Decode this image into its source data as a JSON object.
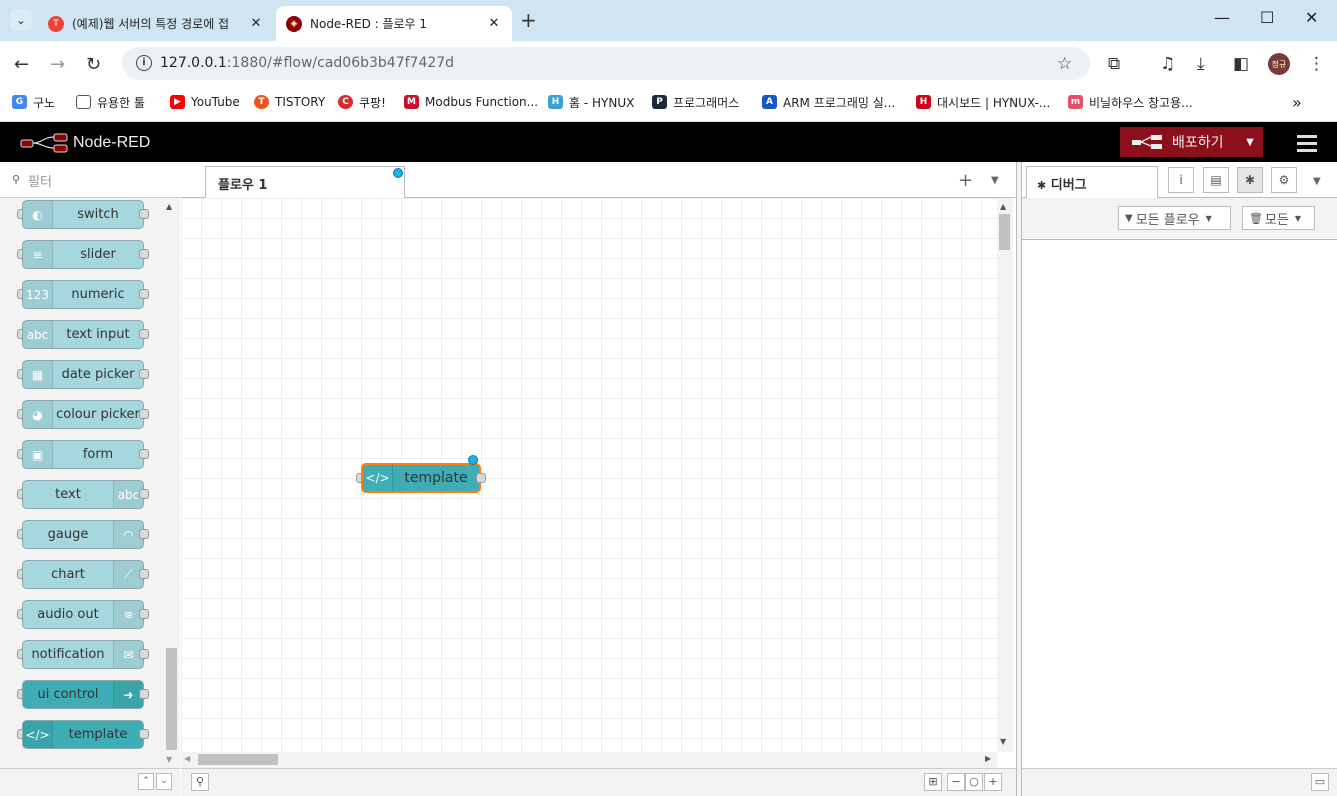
{
  "browser": {
    "tabs": [
      {
        "title": "(예제)웹 서버의 특정 경로에 접",
        "active": false,
        "favicon_color": "#e8453c"
      },
      {
        "title": "Node-RED : 플로우 1",
        "active": true,
        "favicon_color": "#8f0000"
      }
    ],
    "url": {
      "host": "127.0.0.1",
      "rest": ":1880/#flow/cad06b3b47f7427d"
    },
    "bookmarks": [
      {
        "label": "구노",
        "color": "#4285f4",
        "icon": "G"
      },
      {
        "label": "유용한 툴",
        "color": "#555555",
        "icon": "folder"
      },
      {
        "label": "YouTube",
        "color": "#ff0000",
        "icon": "▶"
      },
      {
        "label": "TISTORY",
        "color": "#eb531f",
        "icon": "T"
      },
      {
        "label": "쿠팡!",
        "color": "#d92b2b",
        "icon": "C"
      },
      {
        "label": "Modbus Function...",
        "color": "#c8102e",
        "icon": "M"
      },
      {
        "label": "홈 - HYNUX",
        "color": "#3aa3d6",
        "icon": "H"
      },
      {
        "label": "프로그래머스",
        "color": "#1e2a3a",
        "icon": "P"
      },
      {
        "label": "ARM 프로그래밍 실...",
        "color": "#1a56c9",
        "icon": "A"
      },
      {
        "label": "대시보드 | HYNUX-...",
        "color": "#d0021b",
        "icon": "H"
      },
      {
        "label": "비닐하우스 창고용...",
        "color": "#e94d6a",
        "icon": "m"
      }
    ],
    "avatar_text": "정규"
  },
  "nodered": {
    "title": "Node-RED",
    "deploy_label": "배포하기",
    "filter_placeholder": "필터",
    "palette": [
      {
        "label": "switch",
        "icon": "toggle-icon",
        "glyph": "◐",
        "dark": false,
        "right": false
      },
      {
        "label": "slider",
        "icon": "slider-icon",
        "glyph": "≡",
        "dark": false,
        "right": false
      },
      {
        "label": "numeric",
        "icon": "numeric-icon",
        "glyph": "123",
        "dark": false,
        "right": false
      },
      {
        "label": "text input",
        "icon": "text-input-icon",
        "glyph": "abc",
        "dark": false,
        "right": false
      },
      {
        "label": "date picker",
        "icon": "calendar-icon",
        "glyph": "▦",
        "dark": false,
        "right": false
      },
      {
        "label": "colour picker",
        "icon": "palette-icon",
        "glyph": "◕",
        "dark": false,
        "right": false
      },
      {
        "label": "form",
        "icon": "form-icon",
        "glyph": "▣",
        "dark": false,
        "right": false
      },
      {
        "label": "text",
        "icon": "text-icon",
        "glyph": "abc",
        "dark": false,
        "right": true
      },
      {
        "label": "gauge",
        "icon": "gauge-icon",
        "glyph": "◠",
        "dark": false,
        "right": true
      },
      {
        "label": "chart",
        "icon": "chart-icon",
        "glyph": "⟋",
        "dark": false,
        "right": true
      },
      {
        "label": "audio out",
        "icon": "audio-icon",
        "glyph": "≋",
        "dark": false,
        "right": true
      },
      {
        "label": "notification",
        "icon": "envelope-icon",
        "glyph": "✉",
        "dark": false,
        "right": true
      },
      {
        "label": "ui control",
        "icon": "arrow-icon",
        "glyph": "➜",
        "dark": true,
        "right": true
      },
      {
        "label": "template",
        "icon": "code-icon",
        "glyph": "</>",
        "dark": true,
        "right": false
      }
    ],
    "flow_tab": "플로우 1",
    "flow_node": {
      "label": "template",
      "glyph": "</>"
    },
    "sidebar": {
      "debug_tab": "디버그",
      "filter_flows": "모든 플로우",
      "clear_all": "모든"
    }
  }
}
